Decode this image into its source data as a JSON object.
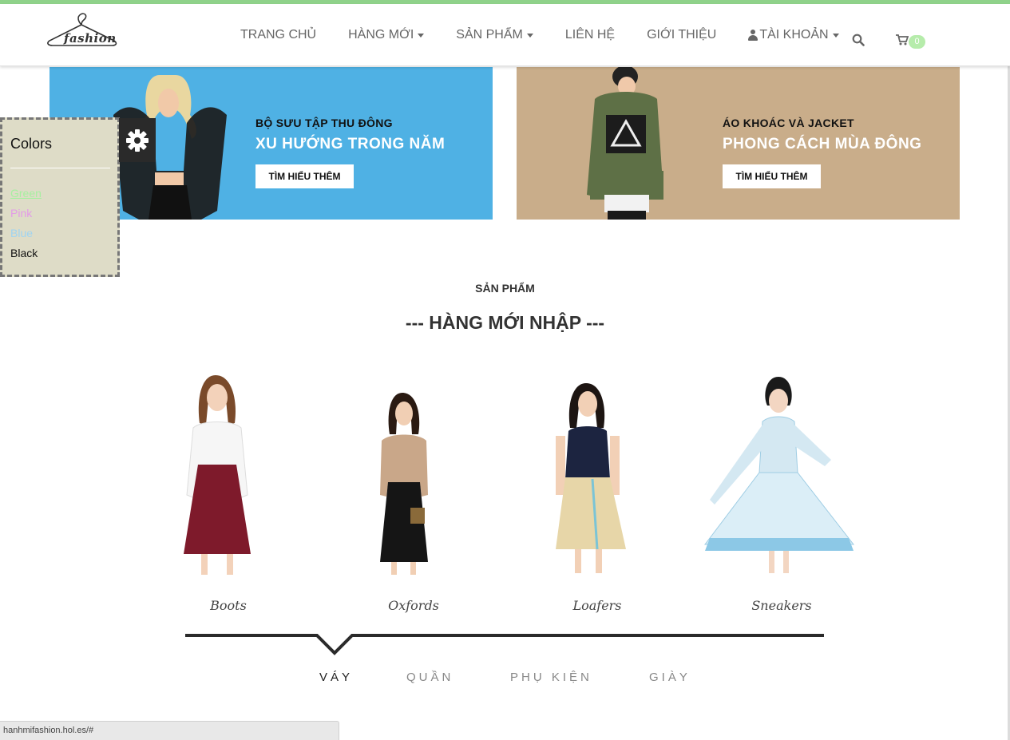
{
  "header": {
    "logo_text": "fashion",
    "nav": [
      {
        "label": "TRANG CHỦ",
        "dropdown": false
      },
      {
        "label": "HÀNG MỚI",
        "dropdown": true
      },
      {
        "label": "SẢN PHẨM",
        "dropdown": true
      },
      {
        "label": "LIÊN HỆ",
        "dropdown": false
      },
      {
        "label": "GIỚI THIỆU",
        "dropdown": false
      },
      {
        "label": "TÀI KHOẢN",
        "dropdown": true,
        "icon": "user-icon"
      }
    ],
    "search_icon": "search-icon",
    "cart_icon": "cart-icon",
    "cart_count": "0"
  },
  "banners": [
    {
      "subtitle": "BỘ SƯU TẬP THU ĐÔNG",
      "title": "XU HƯỚNG TRONG NĂM",
      "button": "TÌM HIỂU THÊM",
      "bg": "#4fb1e4"
    },
    {
      "subtitle": "ÁO KHOÁC VÀ JACKET",
      "title": "PHONG CÁCH MÙA ĐÔNG",
      "button": "TÌM HIỂU THÊM",
      "bg": "#c9ad8a"
    }
  ],
  "color_panel": {
    "title": "Colors",
    "options": [
      {
        "label": "Green",
        "color": "#a6f0a0"
      },
      {
        "label": "Pink",
        "color": "#e39be8"
      },
      {
        "label": "Blue",
        "color": "#9fd4f2"
      },
      {
        "label": "Black",
        "color": "#111111"
      }
    ],
    "gear_icon": "gear-icon"
  },
  "section": {
    "subtitle": "SẢN PHẨM",
    "title": "--- HÀNG MỚI NHẬP ---"
  },
  "products": [
    {
      "name": "Boots"
    },
    {
      "name": "Oxfords"
    },
    {
      "name": "Loafers"
    },
    {
      "name": "Sneakers"
    }
  ],
  "tabs": [
    {
      "label": "VÁY",
      "active": true
    },
    {
      "label": "QUẦN",
      "active": false
    },
    {
      "label": "PHỤ KIỆN",
      "active": false
    },
    {
      "label": "GIÀY",
      "active": false
    }
  ],
  "status_bar": {
    "url": "hanhmifashion.hol.es/#"
  }
}
